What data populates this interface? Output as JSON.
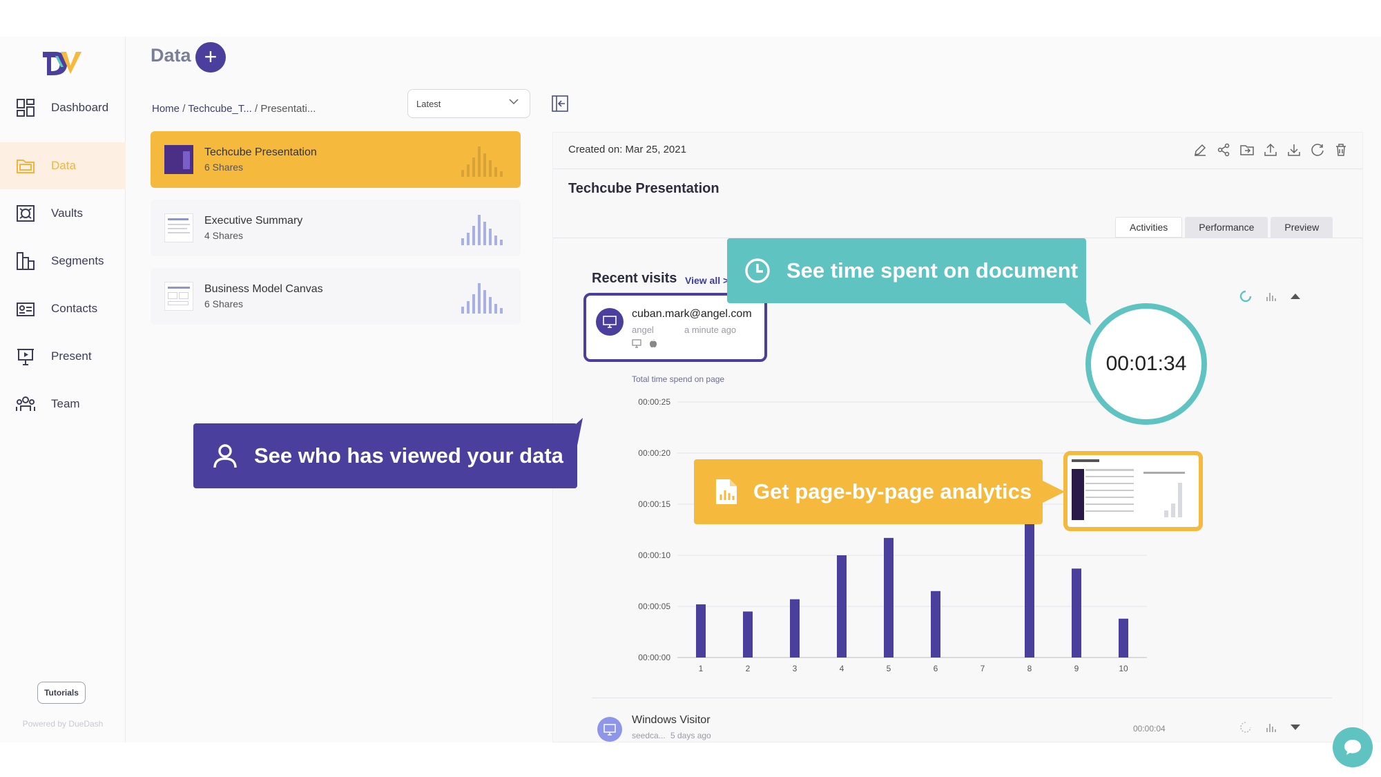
{
  "app": {
    "logo_text": "DV",
    "page_title": "Data"
  },
  "sidebar": {
    "items": [
      {
        "label": "Dashboard",
        "icon": "dashboard-icon"
      },
      {
        "label": "Data",
        "icon": "folder-icon",
        "active": true
      },
      {
        "label": "Vaults",
        "icon": "vault-icon"
      },
      {
        "label": "Segments",
        "icon": "segments-icon"
      },
      {
        "label": "Contacts",
        "icon": "contacts-icon"
      },
      {
        "label": "Present",
        "icon": "present-icon"
      },
      {
        "label": "Team",
        "icon": "team-icon"
      }
    ],
    "tutorials_label": "Tutorials",
    "powered_by": "Powered by DueDash"
  },
  "list": {
    "breadcrumb": [
      "Home",
      "Techcube_T...",
      "Presentati..."
    ],
    "sort_select": "Latest",
    "documents": [
      {
        "name": "Techcube Presentation",
        "shares": "6 Shares",
        "selected": true
      },
      {
        "name": "Executive Summary",
        "shares": "4 Shares"
      },
      {
        "name": "Business Model Canvas",
        "shares": "6 Shares"
      }
    ]
  },
  "detail": {
    "created": "Created on: Mar 25, 2021",
    "title": "Techcube Presentation",
    "tabs": [
      "Activities",
      "Performance",
      "Preview"
    ],
    "recent_visits": "Recent visits",
    "view_all": "View all >",
    "visitor": {
      "email": "cuban.mark@angel.com",
      "org": "angel",
      "time": "a minute ago",
      "duration": "00:01:34"
    },
    "chart_caption": "Total time spend on page",
    "visitor2": {
      "name": "Windows Visitor",
      "org": "seedca...",
      "time": "5 days ago",
      "duration": "00:00:04"
    }
  },
  "callouts": {
    "viewers": "See who has viewed your data",
    "time_spent": "See time spent on document",
    "page_analytics": "Get page-by-page analytics"
  },
  "colors": {
    "accent_purple": "#4a3f9d",
    "accent_yellow": "#f5b93e",
    "accent_teal": "#5ec3c1",
    "bar": "#4a3f9d"
  },
  "chart_data": {
    "type": "bar",
    "categories": [
      "1",
      "2",
      "3",
      "4",
      "5",
      "6",
      "7",
      "8",
      "9",
      "10"
    ],
    "values": [
      5.2,
      4.5,
      5.7,
      10.0,
      11.7,
      6.5,
      0,
      16.5,
      8.7,
      3.8
    ],
    "y_ticks": [
      "00:00:00",
      "00:00:05",
      "00:00:10",
      "00:00:15",
      "00:00:20",
      "00:00:25"
    ],
    "ylim": [
      0,
      25
    ],
    "grid": true
  }
}
